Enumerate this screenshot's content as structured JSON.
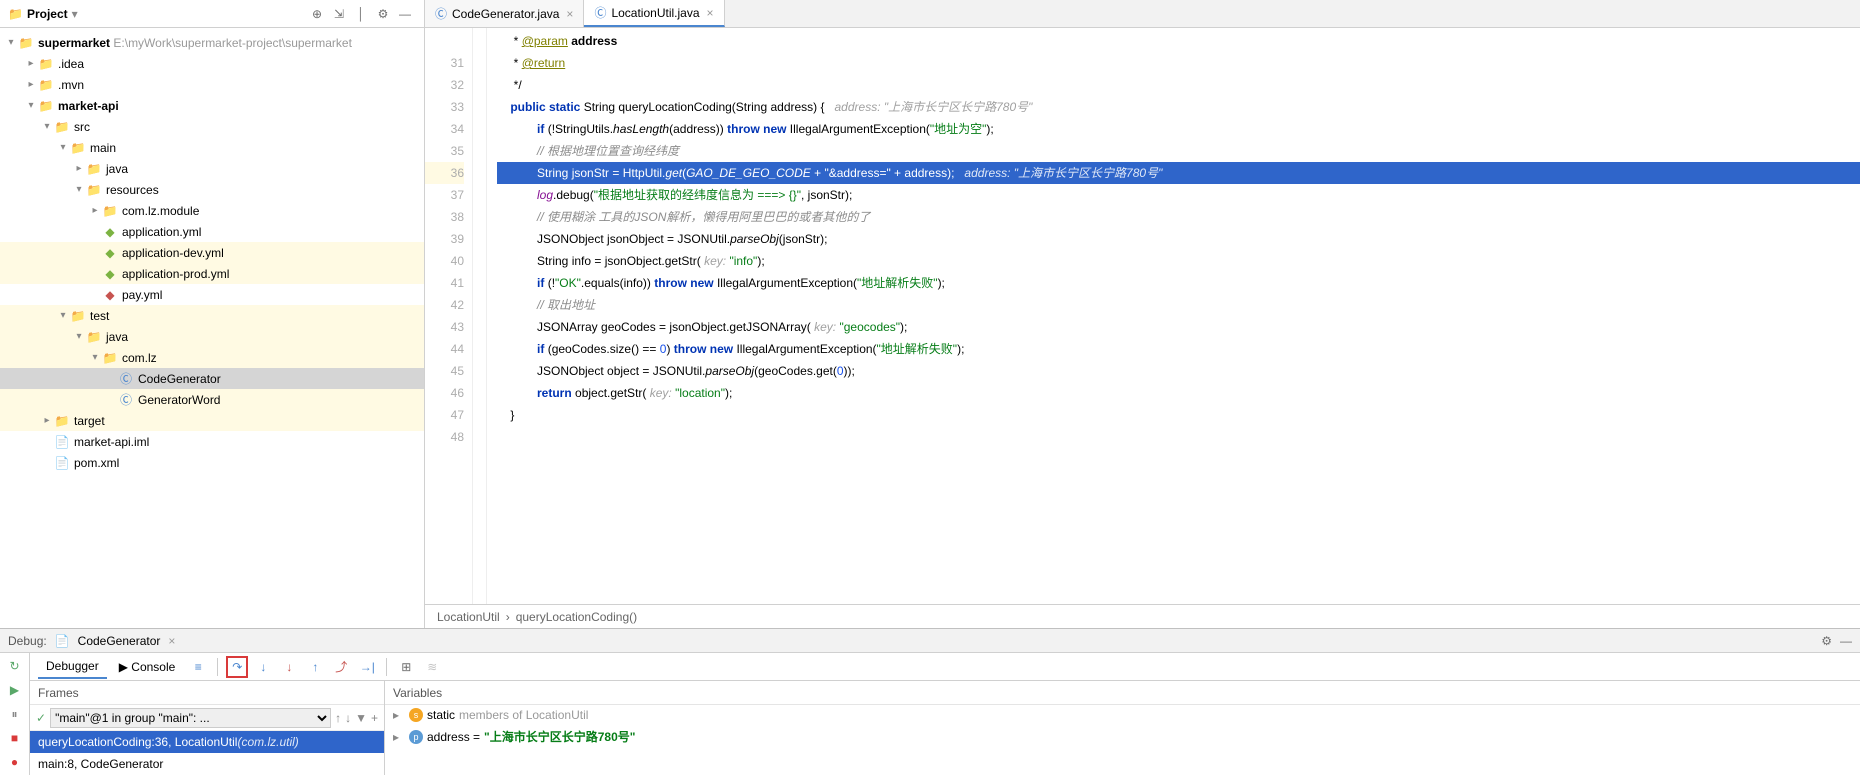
{
  "project": {
    "panel_title": "Project",
    "root": {
      "name": "supermarket",
      "path": "E:\\myWork\\supermarket-project\\supermarket"
    },
    "tree": [
      {
        "d": 1,
        "icon": "folder",
        "name": ".idea",
        "arr": "▸"
      },
      {
        "d": 1,
        "icon": "folder",
        "name": ".mvn",
        "arr": "▸"
      },
      {
        "d": 1,
        "icon": "folder",
        "name": "market-api",
        "arr": "▾",
        "bold": true
      },
      {
        "d": 2,
        "icon": "folder-blue",
        "name": "src",
        "arr": "▾"
      },
      {
        "d": 3,
        "icon": "folder-blue",
        "name": "main",
        "arr": "▾"
      },
      {
        "d": 4,
        "icon": "folder-blue",
        "name": "java",
        "arr": "▸"
      },
      {
        "d": 4,
        "icon": "folder-blue",
        "name": "resources",
        "arr": "▾"
      },
      {
        "d": 5,
        "icon": "folder",
        "name": "com.lz.module",
        "arr": "▸"
      },
      {
        "d": 5,
        "icon": "yml",
        "name": "application.yml"
      },
      {
        "d": 5,
        "icon": "yml",
        "name": "application-dev.yml",
        "hl": true
      },
      {
        "d": 5,
        "icon": "yml",
        "name": "application-prod.yml",
        "hl": true
      },
      {
        "d": 5,
        "icon": "yml-red",
        "name": "pay.yml"
      },
      {
        "d": 3,
        "icon": "folder-blue",
        "name": "test",
        "arr": "▾",
        "hl": true
      },
      {
        "d": 4,
        "icon": "folder-blue",
        "name": "java",
        "arr": "▾",
        "hl": true
      },
      {
        "d": 5,
        "icon": "folder",
        "name": "com.lz",
        "arr": "▾",
        "hl": true
      },
      {
        "d": 6,
        "icon": "class",
        "name": "CodeGenerator",
        "sel": true
      },
      {
        "d": 6,
        "icon": "class",
        "name": "GeneratorWord",
        "hl": true
      },
      {
        "d": 2,
        "icon": "folder-orange",
        "name": "target",
        "arr": "▸",
        "hl": true
      },
      {
        "d": 2,
        "icon": "file",
        "name": "market-api.iml"
      },
      {
        "d": 2,
        "icon": "file",
        "name": "pom.xml"
      }
    ]
  },
  "editor": {
    "tabs": [
      {
        "name": "CodeGenerator.java",
        "active": false
      },
      {
        "name": "LocationUtil.java",
        "active": true
      }
    ],
    "lines": [
      {
        "n": "",
        "html": "&nbsp;* <span class='tag'>@param</span>&nbsp;<b>address</b>"
      },
      {
        "n": "31",
        "html": "&nbsp;* <span class='tag'>@return</span>"
      },
      {
        "n": "32",
        "html": "&nbsp;*/"
      },
      {
        "n": "33",
        "html": "<span class='kw'>public static</span> String queryLocationCoding(String address) {   <span class='hint'>address: \"上海市长宁区长宁路780号\"</span>"
      },
      {
        "n": "34",
        "html": "    <span class='kw'>if</span> (!StringUtils.<span class='mth'>hasLength</span>(address)) <span class='kw'>throw new</span> IllegalArgumentException(<span class='str'>\"地址为空\"</span>);"
      },
      {
        "n": "35",
        "html": "    <span class='cmt'>// 根据地理位置查询经纬度</span>"
      },
      {
        "n": "36",
        "sel": true,
        "html": "    String jsonStr = HttpUtil.<span class='mth'>get</span>(<span class='const'>GAO_DE_GEO_CODE</span> + <span class='str'>\"&address=\"</span> + address);   <span class='hint'>address: \"上海市长宁区长宁路780号\"</span>"
      },
      {
        "n": "37",
        "html": "    <span class='const'>log</span>.debug(<span class='str'>\"根据地址获取的经纬度信息为 ===> {}\"</span>, jsonStr);"
      },
      {
        "n": "38",
        "html": "    <span class='cmt'>// 使用糊涂 工具的JSON解析，懒得用阿里巴巴的或者其他的了</span>"
      },
      {
        "n": "39",
        "html": "    JSONObject jsonObject = JSONUtil.<span class='mth'>parseObj</span>(jsonStr);"
      },
      {
        "n": "40",
        "html": "    String info = jsonObject.getStr( <span class='hint'>key:</span> <span class='str'>\"info\"</span>);"
      },
      {
        "n": "41",
        "html": "    <span class='kw'>if</span> (!<span class='str'>\"OK\"</span>.equals(info)) <span class='kw'>throw new</span> IllegalArgumentException(<span class='str'>\"地址解析失败\"</span>);"
      },
      {
        "n": "42",
        "html": "    <span class='cmt'>// 取出地址</span>"
      },
      {
        "n": "43",
        "html": "    JSONArray geoCodes = jsonObject.getJSONArray( <span class='hint'>key:</span> <span class='str'>\"geocodes\"</span>);"
      },
      {
        "n": "44",
        "html": "    <span class='kw'>if</span> (geoCodes.size() == <span class='num'>0</span>) <span class='kw'>throw new</span> IllegalArgumentException(<span class='str'>\"地址解析失败\"</span>);"
      },
      {
        "n": "45",
        "html": "    JSONObject object = JSONUtil.<span class='mth'>parseObj</span>(geoCodes.get(<span class='num'>0</span>));"
      },
      {
        "n": "46",
        "html": "    <span class='kw'>return</span> object.getStr( <span class='hint'>key:</span> <span class='str'>\"location\"</span>);"
      },
      {
        "n": "47",
        "html": "}"
      },
      {
        "n": "48",
        "html": ""
      }
    ],
    "crumbs": [
      "LocationUtil",
      "queryLocationCoding()"
    ]
  },
  "debug": {
    "title": "Debug:",
    "session": "CodeGenerator",
    "tabs": {
      "debugger": "Debugger",
      "console": "Console"
    },
    "frames_title": "Frames",
    "vars_title": "Variables",
    "thread": "\"main\"@1 in group \"main\": ...",
    "frames": [
      {
        "text": "queryLocationCoding:36, LocationUtil ",
        "pkg": "(com.lz.util)",
        "sel": true
      },
      {
        "text": "main:8, CodeGenerator",
        "sel": false
      }
    ],
    "vars": [
      {
        "badge": "s",
        "label": "static ",
        "dim": "members of LocationUtil"
      },
      {
        "badge": "p",
        "label": "address = ",
        "val": "\"上海市长宁区长宁路780号\""
      }
    ]
  }
}
